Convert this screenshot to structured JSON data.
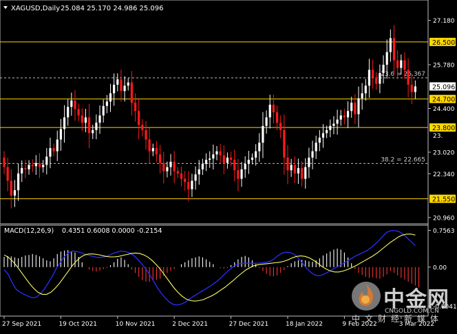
{
  "header": {
    "symbol": "XAGUSD,Daily",
    "ohlc": "25.084 25.170 24.986 25.096",
    "dropdown_icon": "triangle-down-icon"
  },
  "macd_header": {
    "label": "MACD(12,26,9)",
    "values": "0.4351 0.6008 0.0000 -0.2154"
  },
  "colors": {
    "background": "#000000",
    "bull": "#ffffff",
    "bear": "#ff1a1a",
    "level_line": "#ffd700",
    "fib_line": "#c0c0c0",
    "macd_line": "#2d2dff",
    "signal_line": "#ffff66",
    "hist_positive": "#ffffff",
    "hist_negative": "#ff3333",
    "current_price_box": "#ffffff",
    "level_label_bg": "#ffd700"
  },
  "price_axis": {
    "ticks": [
      "27.180",
      "25.780",
      "24.400",
      "23.020",
      "22.340",
      "20.960"
    ],
    "tick_values": [
      27.18,
      25.78,
      24.4,
      23.02,
      22.34,
      20.96
    ],
    "partial_tick": "23.",
    "current_price": "25.096",
    "range": [
      20.76,
      27.78
    ]
  },
  "levels": [
    {
      "label": "26.500",
      "value": 26.5
    },
    {
      "label": "24.700",
      "value": 24.7
    },
    {
      "label": "23.800",
      "value": 23.8
    },
    {
      "label": "21.550",
      "value": 21.55
    }
  ],
  "fib_levels": [
    {
      "label": "23.6 = 25.367",
      "value": 25.367
    },
    {
      "label": "38.2 = 22.665",
      "value": 22.665
    }
  ],
  "macd_axis": {
    "ticks": [
      "0.7563",
      "0.00",
      "-0.8041"
    ],
    "tick_values": [
      0.7563,
      0.0,
      -0.8041
    ],
    "range": [
      -0.98,
      0.82
    ]
  },
  "x_axis": {
    "labels": [
      "27 Sep 2021",
      "19 Oct 2021",
      "10 Nov 2021",
      "2 Dec 2021",
      "27 Dec 2021",
      "18 Jan 2022",
      "9 Feb 2022",
      "3 Mar 2022"
    ],
    "label_bar_index": [
      0,
      16,
      32,
      48,
      64,
      80,
      96,
      112
    ]
  },
  "chart_data": {
    "type": "candlestick",
    "symbol": "XAGUSD",
    "timeframe": "Daily",
    "yrange": [
      20.76,
      27.78
    ],
    "x_start": "27 Sep 2021",
    "closes": [
      22.55,
      22.12,
      21.65,
      21.82,
      22.35,
      22.52,
      22.48,
      22.62,
      22.58,
      22.68,
      22.55,
      22.62,
      22.88,
      23.15,
      23.05,
      23.42,
      23.75,
      24.12,
      24.45,
      24.65,
      24.38,
      24.18,
      23.95,
      24.12,
      23.62,
      23.72,
      23.95,
      24.18,
      24.48,
      24.62,
      24.88,
      25.15,
      25.32,
      24.95,
      25.12,
      25.22,
      24.58,
      24.32,
      23.88,
      23.72,
      23.42,
      23.05,
      23.15,
      22.95,
      22.68,
      22.42,
      22.55,
      22.72,
      22.42,
      22.35,
      22.18,
      22.08,
      21.85,
      22.12,
      22.32,
      22.48,
      22.65,
      22.78,
      22.82,
      22.95,
      23.05,
      22.92,
      22.68,
      22.85,
      22.78,
      22.45,
      22.18,
      22.48,
      22.65,
      22.78,
      22.85,
      23.05,
      23.32,
      23.85,
      24.12,
      24.52,
      24.28,
      23.95,
      23.72,
      22.85,
      22.45,
      22.62,
      22.35,
      22.52,
      22.18,
      22.55,
      22.85,
      23.05,
      23.32,
      23.48,
      23.62,
      23.72,
      23.85,
      23.92,
      24.05,
      24.18,
      24.12,
      24.32,
      24.58,
      24.22,
      24.72,
      24.88,
      25.12,
      25.62,
      25.38,
      25.18,
      25.52,
      25.78,
      26.18,
      26.62,
      25.92,
      25.68,
      25.92,
      25.62,
      25.15,
      24.92,
      25.096
    ],
    "note_open": "first candle opens at 22.85"
  },
  "macd_data": {
    "macd": [
      -0.05,
      -0.15,
      -0.32,
      -0.46,
      -0.52,
      -0.56,
      -0.6,
      -0.63,
      -0.62,
      -0.55,
      -0.45,
      -0.32,
      -0.18,
      -0.02,
      0.1,
      0.22,
      0.3,
      0.33,
      0.32,
      0.3,
      0.27,
      0.24,
      0.22,
      0.2,
      0.2,
      0.21,
      0.24,
      0.28,
      0.31,
      0.33,
      0.32,
      0.3,
      0.25,
      0.17,
      0.08,
      -0.02,
      -0.14,
      -0.28,
      -0.42,
      -0.54,
      -0.64,
      -0.72,
      -0.77,
      -0.78,
      -0.76,
      -0.72,
      -0.66,
      -0.6,
      -0.55,
      -0.5,
      -0.45,
      -0.4,
      -0.34,
      -0.28,
      -0.2,
      -0.12,
      -0.05,
      0.02,
      0.06,
      0.08,
      0.08,
      0.08,
      0.08,
      0.08,
      0.09,
      0.1,
      0.12,
      0.17,
      0.24,
      0.29,
      0.31,
      0.3,
      0.26,
      0.18,
      0.08,
      -0.02,
      -0.1,
      -0.16,
      -0.18,
      -0.16,
      -0.12,
      -0.07,
      -0.02,
      0.02,
      0.07,
      0.12,
      0.17,
      0.22,
      0.26,
      0.3,
      0.34,
      0.4,
      0.47,
      0.55,
      0.64,
      0.72,
      0.75,
      0.75,
      0.73,
      0.68,
      0.6,
      0.52,
      0.44
    ],
    "signal": [
      0.25,
      0.2,
      0.12,
      0.02,
      -0.1,
      -0.22,
      -0.34,
      -0.44,
      -0.52,
      -0.56,
      -0.56,
      -0.52,
      -0.44,
      -0.34,
      -0.22,
      -0.1,
      0.02,
      0.12,
      0.2,
      0.25,
      0.27,
      0.27,
      0.26,
      0.24,
      0.22,
      0.21,
      0.21,
      0.22,
      0.24,
      0.26,
      0.28,
      0.29,
      0.28,
      0.25,
      0.2,
      0.13,
      0.04,
      -0.06,
      -0.18,
      -0.3,
      -0.42,
      -0.52,
      -0.6,
      -0.66,
      -0.69,
      -0.7,
      -0.69,
      -0.67,
      -0.63,
      -0.59,
      -0.54,
      -0.48,
      -0.42,
      -0.35,
      -0.28,
      -0.2,
      -0.13,
      -0.06,
      -0.01,
      0.03,
      0.05,
      0.06,
      0.07,
      0.08,
      0.09,
      0.1,
      0.12,
      0.15,
      0.19,
      0.22,
      0.23,
      0.22,
      0.19,
      0.14,
      0.08,
      0.01,
      -0.04,
      -0.08,
      -0.1,
      -0.1,
      -0.08,
      -0.05,
      -0.01,
      0.03,
      0.08,
      0.13,
      0.18,
      0.23,
      0.29,
      0.36,
      0.43,
      0.5,
      0.56,
      0.62,
      0.66,
      0.68,
      0.68,
      0.66
    ],
    "histogram": [
      0.21,
      0.23,
      0.22,
      0.2,
      0.18,
      0.21,
      0.24,
      0.25,
      0.27,
      0.25,
      0.22,
      0.18,
      0.14,
      0.12,
      0.18,
      0.27,
      0.32,
      0.34,
      0.35,
      0.33,
      0.3,
      0.21,
      0.1,
      0.0,
      -0.05,
      -0.08,
      -0.09,
      -0.07,
      -0.04,
      -0.02,
      0.04,
      0.1,
      0.17,
      0.2,
      0.15,
      0.06,
      -0.05,
      -0.12,
      -0.2,
      -0.27,
      -0.3,
      -0.3,
      -0.28,
      -0.26,
      -0.24,
      -0.18,
      -0.12,
      -0.08,
      -0.04,
      0.0,
      0.06,
      0.1,
      0.14,
      0.18,
      0.2,
      0.22,
      0.2,
      0.16,
      0.11,
      0.06,
      0.0,
      -0.02,
      -0.03,
      -0.02,
      0.04,
      0.1,
      0.16,
      0.21,
      0.23,
      0.2,
      0.14,
      0.06,
      -0.02,
      -0.08,
      -0.14,
      -0.18,
      -0.19,
      -0.17,
      -0.12,
      -0.06,
      0.02,
      0.08,
      0.12,
      0.14,
      0.15,
      0.14,
      0.12,
      0.11,
      0.14,
      0.18,
      0.24,
      0.28,
      0.32,
      0.36,
      0.38,
      0.36,
      0.3,
      0.2,
      0.08,
      -0.04,
      -0.12,
      -0.16,
      -0.2,
      -0.22,
      -0.21,
      -0.23,
      -0.24,
      -0.2,
      -0.15,
      -0.08,
      -0.12,
      -0.17,
      -0.22,
      -0.26,
      -0.3,
      -0.34,
      -0.38,
      -0.42
    ]
  },
  "watermark": {
    "name": "中金网",
    "url": "CNGOLD.COM.CN",
    "subtitle": "中文财经新媒体",
    "logo_icon": "flame-logo-icon"
  }
}
